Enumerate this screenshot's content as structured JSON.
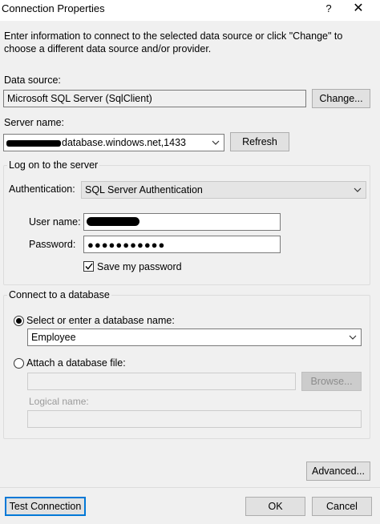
{
  "window": {
    "title": "Connection Properties",
    "help_label": "?",
    "close_label": "✕"
  },
  "instructions": "Enter information to connect to the selected data source or click \"Change\" to choose a different data source and/or provider.",
  "data_source": {
    "label": "Data source:",
    "value": "Microsoft SQL Server (SqlClient)",
    "change_label": "Change..."
  },
  "server": {
    "label": "Server name:",
    "value_visible": "database.windows.net,1433",
    "refresh_label": "Refresh"
  },
  "logon": {
    "title": "Log on to the server",
    "auth_label": "Authentication:",
    "auth_value": "SQL Server Authentication",
    "user_label": "User name:",
    "password_label": "Password:",
    "password_mask": "●●●●●●●●●●●",
    "save_password_label": "Save my password",
    "save_password_checked": true
  },
  "database": {
    "title": "Connect to a database",
    "select_label": "Select or enter a database name:",
    "select_value": "Employee",
    "attach_label": "Attach a database file:",
    "attach_value": "",
    "browse_label": "Browse...",
    "logical_label": "Logical name:",
    "logical_value": ""
  },
  "footer": {
    "advanced_label": "Advanced...",
    "test_label": "Test Connection",
    "ok_label": "OK",
    "cancel_label": "Cancel"
  },
  "icons": {
    "dropdown": "chevron-down-icon",
    "checkmark": "checkmark-icon"
  }
}
